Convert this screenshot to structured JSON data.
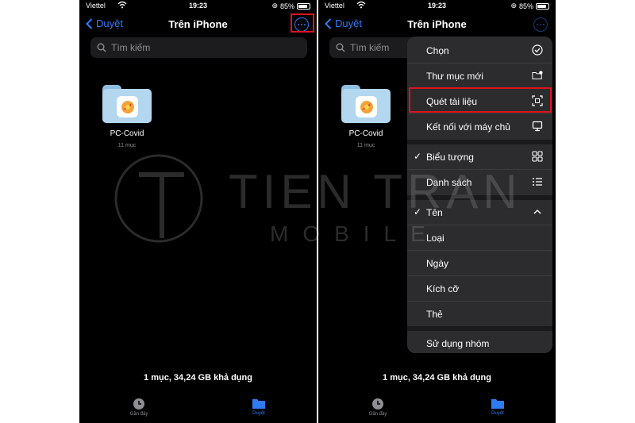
{
  "status": {
    "carrier": "Viettel",
    "time": "19:23",
    "battery": "85%"
  },
  "nav": {
    "back_label": "Duyệt",
    "title": "Trên iPhone"
  },
  "search": {
    "placeholder": "Tìm kiếm"
  },
  "folder": {
    "name": "PC-Covid",
    "count": "11 mục"
  },
  "storage_text": "1 mục, 34,24 GB khả dụng",
  "tabbar": {
    "recent_label": "Gần đây",
    "browse_label": "Duyệt"
  },
  "menu": {
    "select": "Chọn",
    "new_folder": "Thư mục mới",
    "scan_documents": "Quét tài liệu",
    "connect_server": "Kết nối với máy chủ",
    "icons": "Biểu tượng",
    "list": "Danh sách",
    "name": "Tên",
    "kind": "Loại",
    "date": "Ngày",
    "size": "Kích cỡ",
    "tags": "Thẻ",
    "use_groups": "Sử dụng nhóm"
  },
  "watermark": {
    "line1": "TIEN TRAN",
    "line2": "MOBILE"
  },
  "colors": {
    "accent": "#2d7cf6",
    "highlight": "#e0121b",
    "background": "#000000",
    "menu": "#2c2c2e"
  }
}
